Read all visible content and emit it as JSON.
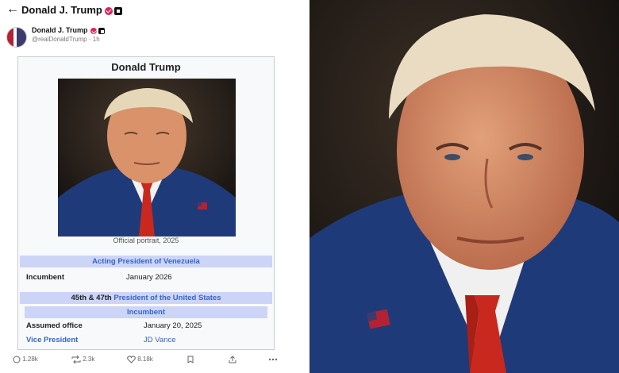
{
  "header": {
    "back_icon": "←",
    "title": "Donald J. Trump"
  },
  "post": {
    "author": "Donald J. Trump",
    "handle": "@realDonaldTrump · 1h"
  },
  "infobox": {
    "title": "Donald Trump",
    "caption": "Official portrait, 2025",
    "office1": {
      "title": "Acting President of Venezuela",
      "label": "Incumbent",
      "value": "January 2026"
    },
    "office2": {
      "ordinal": "45th & 47th",
      "title_link": "President of the United States",
      "status": "Incumbent",
      "assumed_label": "Assumed office",
      "assumed_value": "January 20, 2025",
      "vp_label": "Vice President",
      "vp_value": "JD Vance"
    }
  },
  "actions": {
    "replies": "1.28k",
    "reposts": "2.3k",
    "likes": "8.18k"
  },
  "colors": {
    "infobox_band": "#ccd5f6",
    "link": "#3366cc",
    "suit_blue": "#1f3a78",
    "tie_red": "#c8281e"
  }
}
